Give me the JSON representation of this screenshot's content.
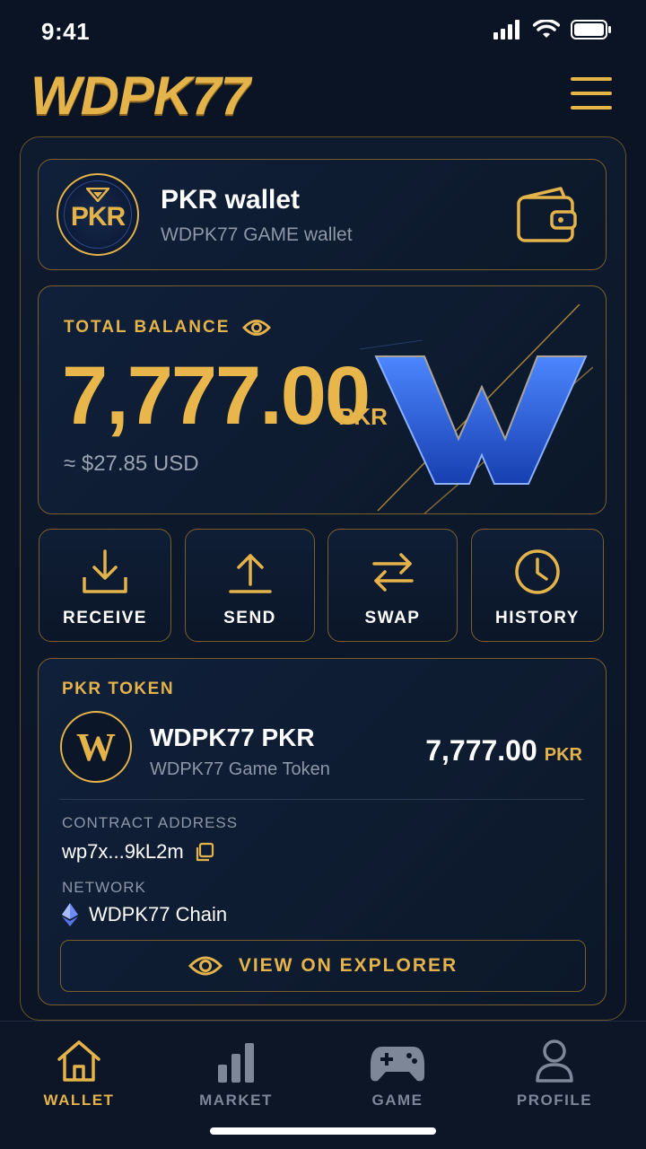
{
  "status_bar": {
    "time": "9:41"
  },
  "header": {
    "logo": "WDPK77"
  },
  "wallet": {
    "badge": "PKR",
    "title": "PKR wallet",
    "subtitle": "WDPK77 GAME wallet"
  },
  "balance": {
    "label": "TOTAL BALANCE",
    "amount": "7,777.00",
    "currency": "PKR",
    "usd": "≈ $27.85 USD"
  },
  "actions": [
    {
      "label": "RECEIVE",
      "icon": "download-icon"
    },
    {
      "label": "SEND",
      "icon": "upload-icon"
    },
    {
      "label": "SWAP",
      "icon": "swap-arrows-icon"
    },
    {
      "label": "HISTORY",
      "icon": "clock-icon"
    }
  ],
  "token": {
    "section_label": "PKR TOKEN",
    "logo": "W",
    "name": "WDPK77 PKR",
    "description": "WDPK77 Game Token",
    "amount": "7,777.00",
    "unit": "PKR",
    "contract_label": "CONTRACT ADDRESS",
    "contract_value": "wp7x...9kL2m",
    "network_label": "NETWORK",
    "network_value": "WDPK77 Chain",
    "explorer_label": "VIEW ON EXPLORER"
  },
  "nav": [
    {
      "label": "WALLET",
      "icon": "home-icon",
      "active": true
    },
    {
      "label": "MARKET",
      "icon": "bar-chart-icon",
      "active": false
    },
    {
      "label": "GAME",
      "icon": "gamepad-icon",
      "active": false
    },
    {
      "label": "PROFILE",
      "icon": "user-icon",
      "active": false
    }
  ],
  "colors": {
    "accent_gold": "#e4b34a",
    "background": "#0a1424",
    "brand_blue": "#2a5fe0"
  }
}
